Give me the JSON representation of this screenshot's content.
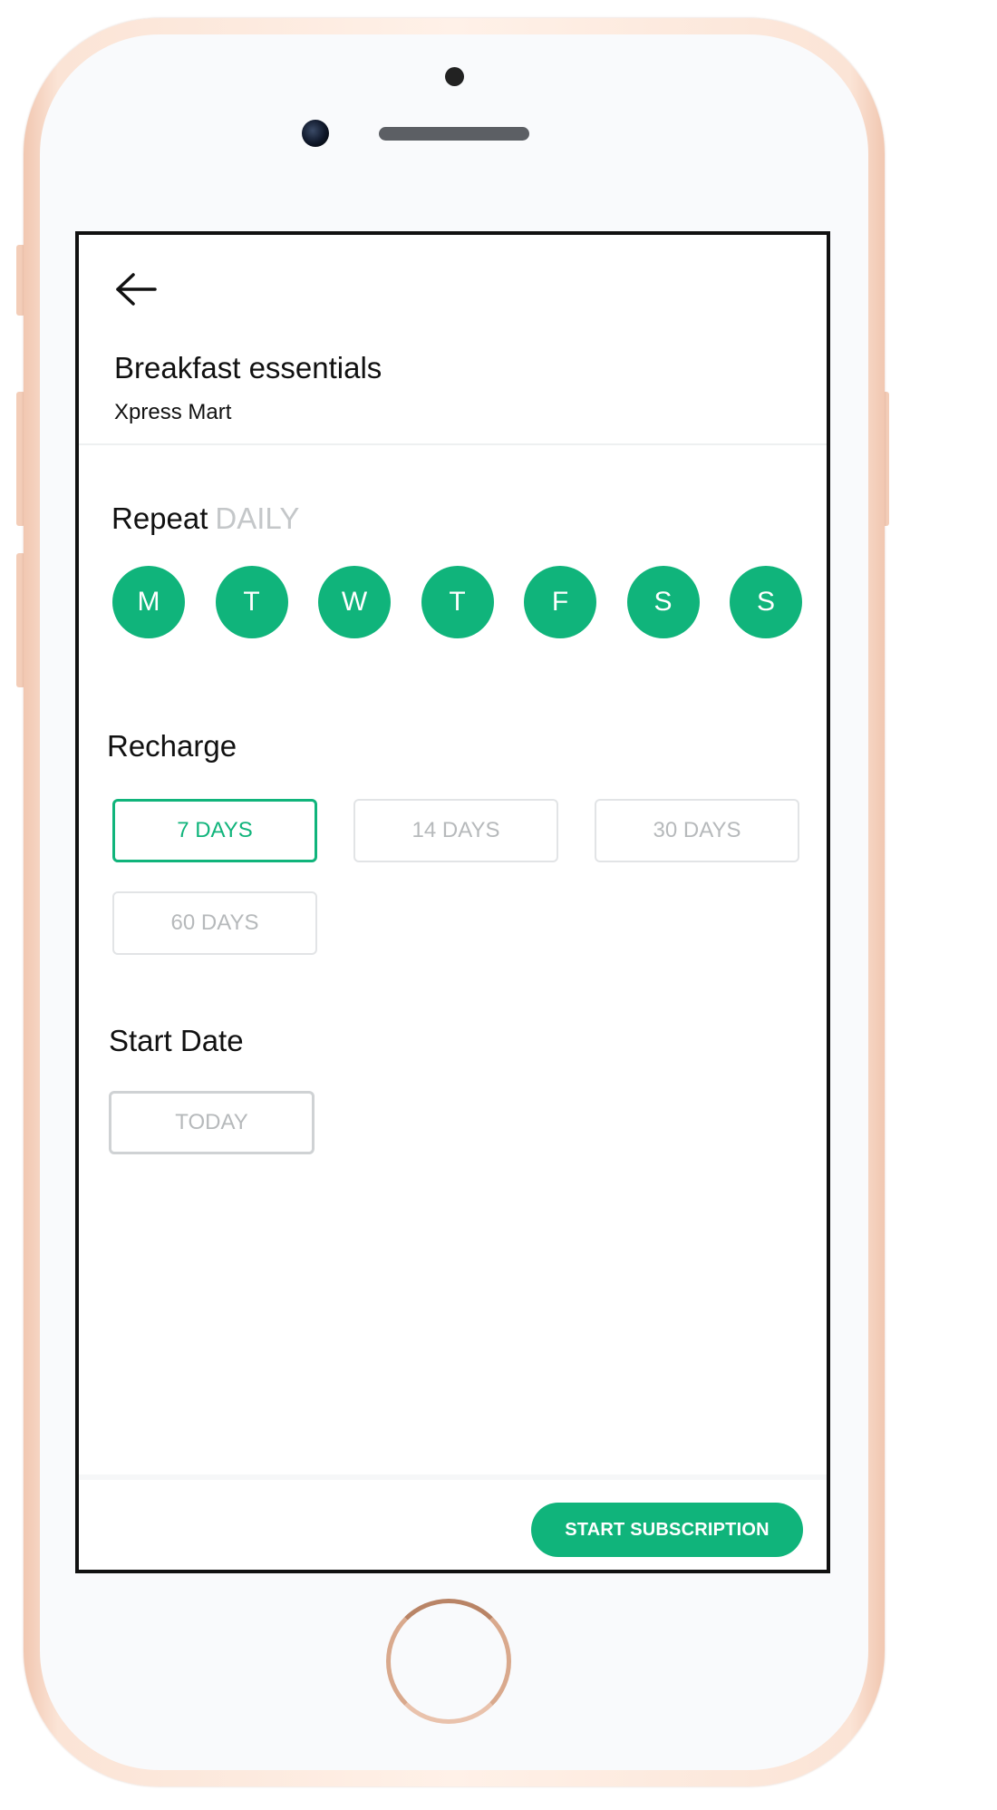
{
  "header": {
    "back_icon": "arrow-left-icon",
    "title": "Breakfast essentials",
    "store": "Xpress Mart"
  },
  "repeat": {
    "label": "Repeat",
    "value": "DAILY",
    "days": [
      "M",
      "T",
      "W",
      "T",
      "F",
      "S",
      "S"
    ],
    "active_color": "#10b47b"
  },
  "recharge": {
    "label": "Recharge",
    "options": [
      "7 DAYS",
      "14 DAYS",
      "30 DAYS",
      "60 DAYS"
    ],
    "selected": "7 DAYS"
  },
  "start_date": {
    "label": "Start Date",
    "value": "TODAY"
  },
  "footer": {
    "cta_label": "START SUBSCRIPTION"
  },
  "colors": {
    "accent": "#10b47b",
    "muted_text": "#b6b9bb",
    "phone_frame": "#f6d6c4"
  }
}
